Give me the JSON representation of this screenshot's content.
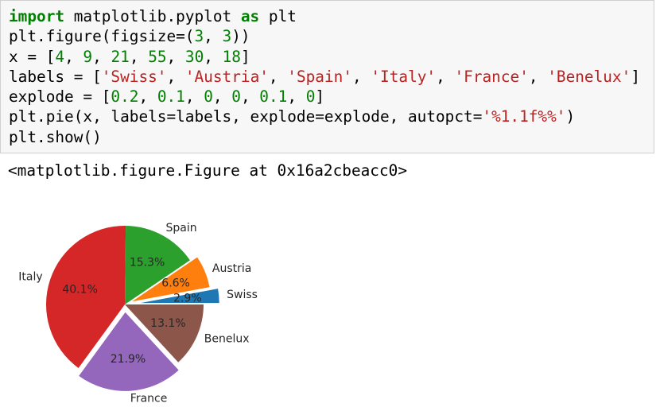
{
  "notebook": {
    "code_lines": [
      [
        {
          "t": "import",
          "c": "kw"
        },
        {
          "t": " matplotlib.pyplot "
        },
        {
          "t": "as",
          "c": "kw"
        },
        {
          "t": " plt"
        }
      ],
      [
        {
          "t": "plt.figure(figsize=("
        },
        {
          "t": "3",
          "c": "num"
        },
        {
          "t": ", "
        },
        {
          "t": "3",
          "c": "num"
        },
        {
          "t": "))"
        }
      ],
      [
        {
          "t": "x = ["
        },
        {
          "t": "4",
          "c": "num"
        },
        {
          "t": ", "
        },
        {
          "t": "9",
          "c": "num"
        },
        {
          "t": ", "
        },
        {
          "t": "21",
          "c": "num"
        },
        {
          "t": ", "
        },
        {
          "t": "55",
          "c": "num"
        },
        {
          "t": ", "
        },
        {
          "t": "30",
          "c": "num"
        },
        {
          "t": ", "
        },
        {
          "t": "18",
          "c": "num"
        },
        {
          "t": "]"
        }
      ],
      [
        {
          "t": "labels = ["
        },
        {
          "t": "'Swiss'",
          "c": "str"
        },
        {
          "t": ", "
        },
        {
          "t": "'Austria'",
          "c": "str"
        },
        {
          "t": ", "
        },
        {
          "t": "'Spain'",
          "c": "str"
        },
        {
          "t": ", "
        },
        {
          "t": "'Italy'",
          "c": "str"
        },
        {
          "t": ", "
        },
        {
          "t": "'France'",
          "c": "str"
        },
        {
          "t": ", "
        },
        {
          "t": "'Benelux'",
          "c": "str"
        },
        {
          "t": "]"
        }
      ],
      [
        {
          "t": "explode = ["
        },
        {
          "t": "0.2",
          "c": "num"
        },
        {
          "t": ", "
        },
        {
          "t": "0.1",
          "c": "num"
        },
        {
          "t": ", "
        },
        {
          "t": "0",
          "c": "num"
        },
        {
          "t": ", "
        },
        {
          "t": "0",
          "c": "num"
        },
        {
          "t": ", "
        },
        {
          "t": "0.1",
          "c": "num"
        },
        {
          "t": ", "
        },
        {
          "t": "0",
          "c": "num"
        },
        {
          "t": "]"
        }
      ],
      [
        {
          "t": "plt.pie(x, labels=labels, explode=explode, autopct="
        },
        {
          "t": "'%1.1f%%'",
          "c": "str"
        },
        {
          "t": ")"
        }
      ],
      [
        {
          "t": "plt.show()"
        }
      ]
    ],
    "output_text": "<matplotlib.figure.Figure at 0x16a2cbeacc0>"
  },
  "chart_data": {
    "type": "pie",
    "categories": [
      "Swiss",
      "Austria",
      "Spain",
      "Italy",
      "France",
      "Benelux"
    ],
    "values": [
      4,
      9,
      21,
      55,
      30,
      18
    ],
    "explode": [
      0.2,
      0.1,
      0,
      0,
      0.1,
      0
    ],
    "percent_labels": [
      "2.9%",
      "6.6%",
      "15.3%",
      "40.1%",
      "21.9%",
      "13.1%"
    ],
    "colors": [
      "#1f77b4",
      "#ff7f0e",
      "#2ca02c",
      "#d62728",
      "#9467bd",
      "#8c564b"
    ],
    "start_angle": 0,
    "direction": "counterclockwise"
  }
}
